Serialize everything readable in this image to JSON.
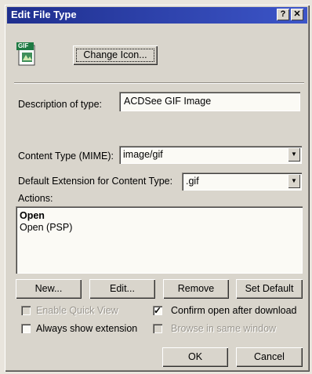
{
  "window": {
    "title": "Edit File Type",
    "help_glyph": "?",
    "close_glyph": "✕"
  },
  "icon": {
    "badge": "GIF"
  },
  "buttons": {
    "change_icon": "Change Icon...",
    "new": "New...",
    "edit": "Edit...",
    "remove": "Remove",
    "set_default": "Set Default",
    "ok": "OK",
    "cancel": "Cancel"
  },
  "description": {
    "label": "Description of type:",
    "value": "ACDSee GIF Image"
  },
  "content_type": {
    "label": "Content Type (MIME):",
    "value": "image/gif"
  },
  "default_extension": {
    "label": "Default Extension for Content Type:",
    "value": ".gif"
  },
  "actions": {
    "label": "Actions:",
    "items": [
      "Open",
      "Open (PSP)"
    ]
  },
  "options": {
    "enable_quick_view": {
      "label": "Enable Quick View",
      "checked": false,
      "enabled": false
    },
    "confirm_open": {
      "label": "Confirm open after download",
      "checked": true,
      "enabled": true
    },
    "always_show_extension": {
      "label": "Always show extension",
      "checked": false,
      "enabled": true
    },
    "browse_same_window": {
      "label": "Browse in same window",
      "checked": false,
      "enabled": false
    }
  },
  "glyphs": {
    "dropdown": "▼",
    "check": "✓"
  }
}
